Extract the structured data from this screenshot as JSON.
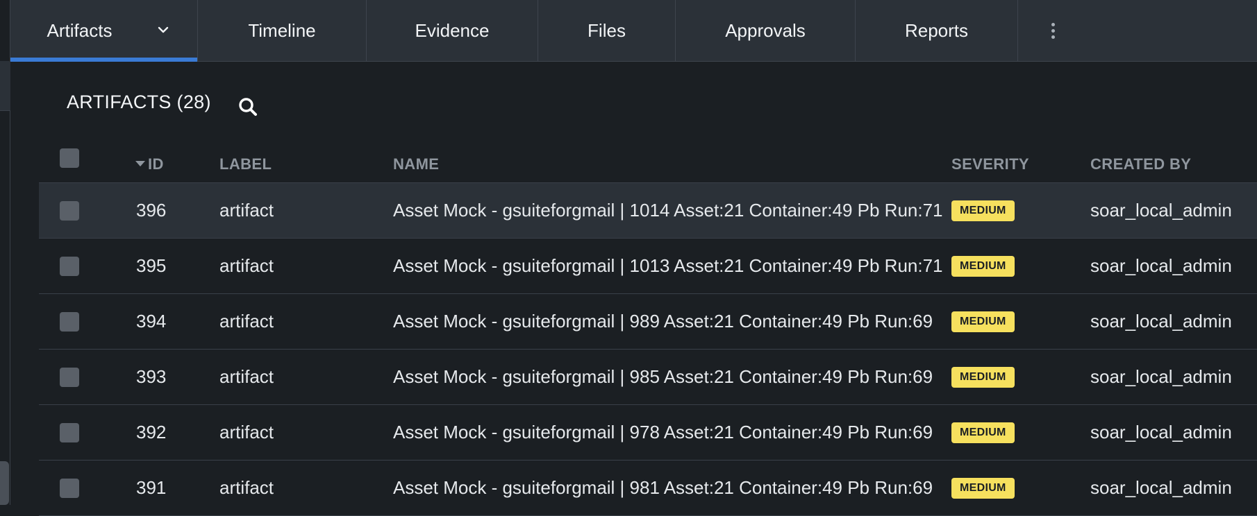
{
  "tabs": [
    {
      "label": "Artifacts",
      "active": true,
      "has_dropdown": true
    },
    {
      "label": "Timeline"
    },
    {
      "label": "Evidence"
    },
    {
      "label": "Files"
    },
    {
      "label": "Approvals"
    },
    {
      "label": "Reports"
    }
  ],
  "section": {
    "title": "ARTIFACTS (28)"
  },
  "columns": {
    "id": "ID",
    "label": "LABEL",
    "name": "NAME",
    "severity": "SEVERITY",
    "created_by": "CREATED BY"
  },
  "rows": [
    {
      "id": "396",
      "label": "artifact",
      "name": "Asset Mock - gsuiteforgmail | 1014 Asset:21 Container:49 Pb Run:71",
      "severity": "MEDIUM",
      "created_by": "soar_local_admin"
    },
    {
      "id": "395",
      "label": "artifact",
      "name": "Asset Mock - gsuiteforgmail | 1013 Asset:21 Container:49 Pb Run:71",
      "severity": "MEDIUM",
      "created_by": "soar_local_admin"
    },
    {
      "id": "394",
      "label": "artifact",
      "name": "Asset Mock - gsuiteforgmail | 989 Asset:21 Container:49 Pb Run:69",
      "severity": "MEDIUM",
      "created_by": "soar_local_admin"
    },
    {
      "id": "393",
      "label": "artifact",
      "name": "Asset Mock - gsuiteforgmail | 985 Asset:21 Container:49 Pb Run:69",
      "severity": "MEDIUM",
      "created_by": "soar_local_admin"
    },
    {
      "id": "392",
      "label": "artifact",
      "name": "Asset Mock - gsuiteforgmail | 978 Asset:21 Container:49 Pb Run:69",
      "severity": "MEDIUM",
      "created_by": "soar_local_admin"
    },
    {
      "id": "391",
      "label": "artifact",
      "name": "Asset Mock - gsuiteforgmail | 981 Asset:21 Container:49 Pb Run:69",
      "severity": "MEDIUM",
      "created_by": "soar_local_admin"
    }
  ],
  "colors": {
    "accent": "#3a7bd5",
    "severity_medium": "#f6e05e",
    "background": "#1b1f23",
    "tabbar": "#2b3138"
  },
  "icons": {
    "search": "search-icon",
    "more": "kebab-icon",
    "dropdown": "chevron-down-icon"
  }
}
